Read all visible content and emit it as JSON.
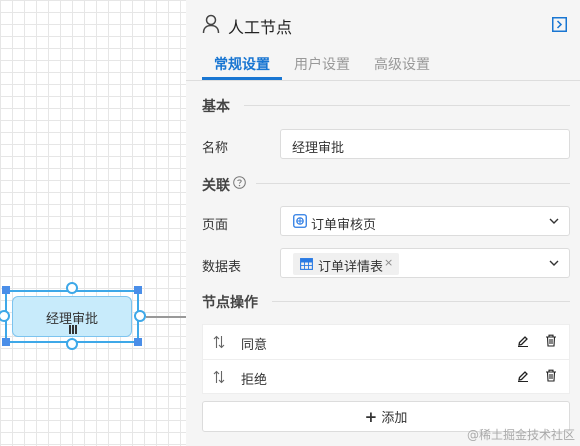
{
  "canvas": {
    "node_label": "经理审批"
  },
  "panel": {
    "title": "人工节点",
    "icons": {
      "title": "user-icon",
      "collapse": "collapse-panel-icon"
    },
    "tabs": [
      {
        "label": "常规设置",
        "active": true
      },
      {
        "label": "用户设置",
        "active": false
      },
      {
        "label": "高级设置",
        "active": false
      }
    ],
    "basic": {
      "section_title": "基本",
      "name_label": "名称",
      "name_value": "经理审批"
    },
    "association": {
      "section_title": "关联",
      "page_label": "页面",
      "page_value": "订单审核页",
      "table_label": "数据表",
      "table_tag": "订单详情表",
      "table_tag_close": "×"
    },
    "operations": {
      "section_title": "节点操作",
      "items": [
        {
          "label": "同意"
        },
        {
          "label": "拒绝"
        }
      ],
      "add_icon": "+",
      "add_label": "添加"
    }
  },
  "watermark": "@稀土掘金技术社区",
  "colors": {
    "accent": "#1976d2",
    "node_fill": "#c8ebfb",
    "node_border": "#3ea8e8",
    "panel_bg": "#f5f5f5"
  }
}
